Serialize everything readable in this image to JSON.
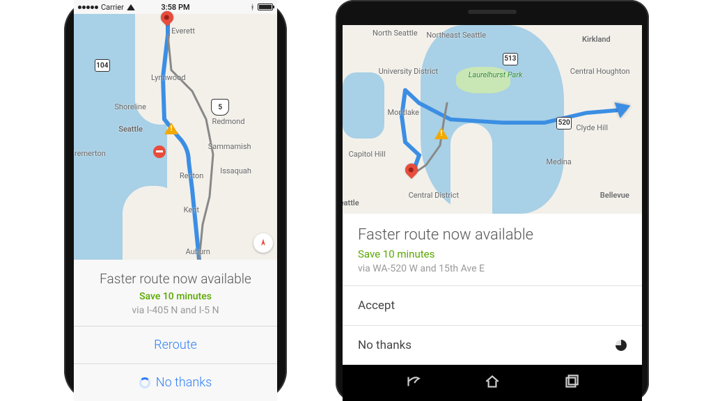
{
  "phone_ios": {
    "statusbar": {
      "carrier": "Carrier",
      "time": "3:58 PM"
    },
    "map": {
      "labels": {
        "everett": "Everett",
        "lynnwood": "Lynnwood",
        "shoreline": "Shoreline",
        "seattle": "Seattle",
        "redmond": "Redmond",
        "sammamish": "Sammamish",
        "issaquah": "Issaquah",
        "renton": "Renton",
        "kent": "Kent",
        "auburn": "Auburn",
        "bremerton": "Bremerton"
      },
      "shields": {
        "r104": "104",
        "r5": "5"
      }
    },
    "sheet": {
      "title": "Faster route now available",
      "save": "Save 10 minutes",
      "via": "via I-405 N and I-5 N",
      "button_primary": "Reroute",
      "button_dismiss": "No thanks"
    }
  },
  "phone_android": {
    "map": {
      "labels": {
        "north_seattle": "North Seattle",
        "northeast_seattle": "Northeast Seattle",
        "kirkland": "Kirkland",
        "university_district": "University District",
        "laurelhurst": "Laurelhurst Park",
        "central_houghton": "Central Houghton",
        "montlake": "Montlake",
        "clyde_hill": "Clyde Hill",
        "capitol_hill": "Capitol Hill",
        "medina": "Medina",
        "bellevue": "Bellevue",
        "central_district": "Central District",
        "seattle": "eattle"
      },
      "shields": {
        "r513": "513",
        "r520": "520"
      }
    },
    "sheet": {
      "title": "Faster route now available",
      "save": "Save 10 minutes",
      "via": "via WA-520 W and 15th Ave E",
      "button_primary": "Accept",
      "button_dismiss": "No thanks"
    }
  }
}
